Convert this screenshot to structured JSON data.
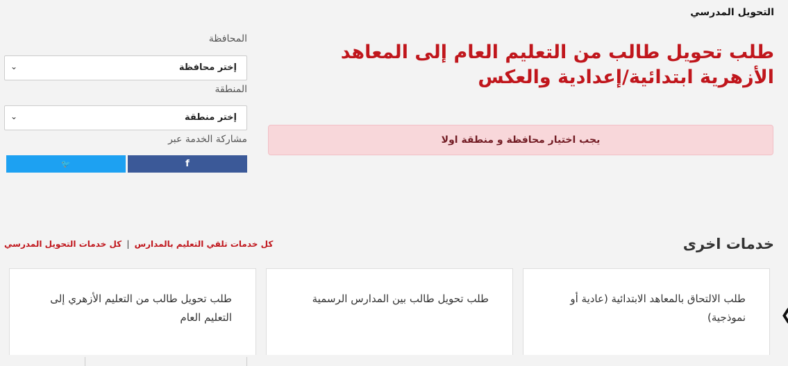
{
  "header": {
    "breadcrumb": "التحويل المدرسي"
  },
  "main": {
    "title": "طلب تحويل طالب من التعليم العام إلى المعاهد الأزهرية ابتدائية/إعدادية والعكس",
    "alert": "يجب اختيار محافظة و منطقة اولا"
  },
  "sidebar": {
    "governorate_label": "المحافظة",
    "governorate_value": "إختر محافظة",
    "region_label": "المنطقة",
    "region_value": "إختر منطقة",
    "share_label": "مشاركة الخدمة عبر",
    "facebook": "f",
    "twitter": "🐦"
  },
  "other_services": {
    "title": "خدمات اخرى",
    "link_school_reception": "كل خدمات تلقي التعليم بالمدارس",
    "separator": "|",
    "link_all_transfer": "كل خدمات التحويل المدرسي",
    "cards": [
      {
        "text": "طلب الالتحاق بالمعاهد الابتدائية (عادية أو نموذجية)"
      },
      {
        "text": "طلب تحويل طالب بين المدارس الرسمية"
      },
      {
        "text": "طلب تحويل طالب من التعليم الأزهري إلى التعليم العام"
      }
    ]
  },
  "colors": {
    "title_red": "#c0161c",
    "alert_bg": "#f8d7da",
    "facebook_blue": "#3b5998",
    "twitter_blue": "#1da1f2"
  }
}
